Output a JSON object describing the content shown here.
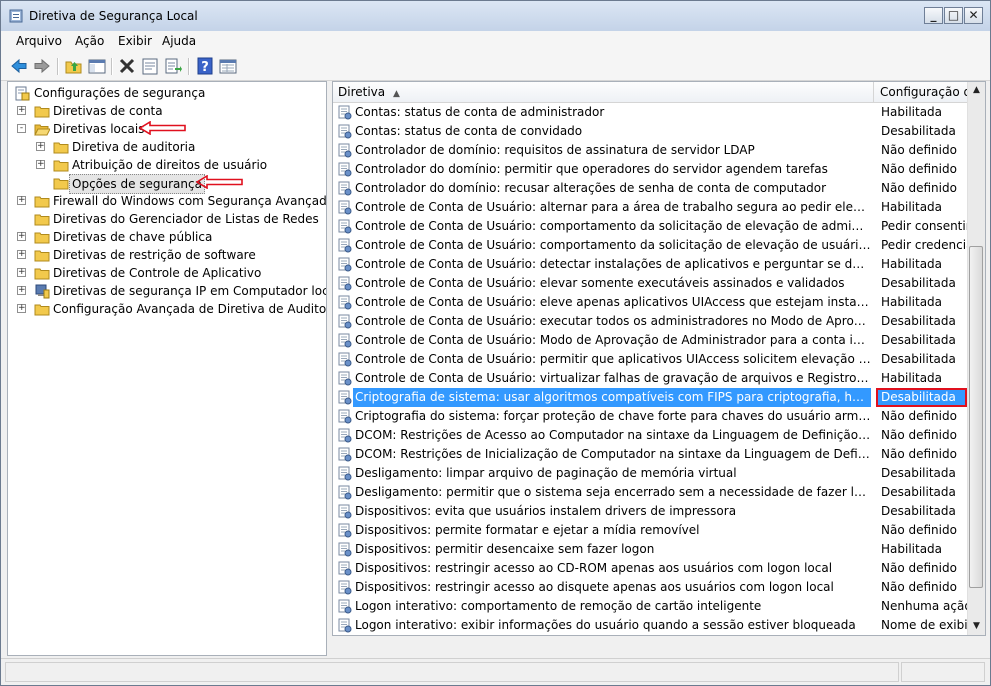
{
  "window": {
    "title": "Diretiva de Segurança Local"
  },
  "menu": [
    "Arquivo",
    "Ação",
    "Exibir",
    "Ajuda"
  ],
  "toolbar": {
    "buttons": [
      "back-icon",
      "forward-icon",
      "up-folder-icon",
      "show-hide-tree-icon",
      "delete-icon",
      "properties-icon",
      "export-list-icon",
      "help-icon",
      "console-view-icon"
    ]
  },
  "tree": {
    "root": "Configurações de segurança",
    "items": [
      {
        "label": "Diretivas de conta",
        "expander": "+"
      },
      {
        "label": "Diretivas locais",
        "expander": "-"
      },
      {
        "label": "Diretiva de auditoria",
        "expander": "+"
      },
      {
        "label": "Atribuição de direitos de usuário",
        "expander": "+"
      },
      {
        "label": "Opções de segurança",
        "expander": ""
      },
      {
        "label": "Firewall do Windows com Segurança Avançada",
        "expander": "+"
      },
      {
        "label": "Diretivas do Gerenciador de Listas de Redes",
        "expander": ""
      },
      {
        "label": "Diretivas de chave pública",
        "expander": "+"
      },
      {
        "label": "Diretivas de restrição de software",
        "expander": "+"
      },
      {
        "label": "Diretivas de Controle de Aplicativo",
        "expander": "+"
      },
      {
        "label": "Diretivas de segurança IP em Computador local",
        "expander": "+"
      },
      {
        "label": "Configuração Avançada de Diretiva de Auditoria",
        "expander": "+"
      }
    ]
  },
  "list": {
    "columns": {
      "policy": "Diretiva",
      "setting": "Configuração de"
    },
    "rows": [
      {
        "policy": "Contas: status de conta de administrador",
        "setting": "Habilitada"
      },
      {
        "policy": "Contas: status de conta de convidado",
        "setting": "Desabilitada"
      },
      {
        "policy": "Controlador de domínio: requisitos de assinatura de servidor LDAP",
        "setting": "Não definido"
      },
      {
        "policy": "Controlador do domínio: permitir que operadores do servidor agendem tarefas",
        "setting": "Não definido"
      },
      {
        "policy": "Controlador do domínio: recusar alterações de senha de conta de computador",
        "setting": "Não definido"
      },
      {
        "policy": "Controle de Conta de Usuário: alternar para a área de trabalho segura ao pedir elevação",
        "setting": "Habilitada"
      },
      {
        "policy": "Controle de Conta de Usuário: comportamento da solicitação de elevação de administradores n...",
        "setting": "Pedir consentim"
      },
      {
        "policy": "Controle de Conta de Usuário: comportamento da solicitação de elevação de usuários padrão",
        "setting": "Pedir credenciais"
      },
      {
        "policy": "Controle de Conta de Usuário: detectar instalações de aplicativos e perguntar se deseja elevar",
        "setting": "Habilitada"
      },
      {
        "policy": "Controle de Conta de Usuário: elevar somente executáveis assinados e validados",
        "setting": "Desabilitada"
      },
      {
        "policy": "Controle de Conta de Usuário: eleve apenas aplicativos UIAccess que estejam instalados em locai...",
        "setting": "Habilitada"
      },
      {
        "policy": "Controle de Conta de Usuário: executar todos os administradores no Modo de Aprovação de Ad...",
        "setting": "Desabilitada"
      },
      {
        "policy": "Controle de Conta de Usuário: Modo de Aprovação de Administrador para a conta interna Admi...",
        "setting": "Desabilitada"
      },
      {
        "policy": "Controle de Conta de Usuário: permitir que aplicativos UIAccess solicitem elevação sem usar a ár...",
        "setting": "Desabilitada"
      },
      {
        "policy": "Controle de Conta de Usuário: virtualizar falhas de gravação de arquivos e Registros para locais p...",
        "setting": "Habilitada"
      },
      {
        "policy": "Criptografia de sistema: usar algoritmos compatíveis com FIPS para criptografia, hash e assinatura",
        "setting": "Desabilitada",
        "selected": true
      },
      {
        "policy": "Criptografia do sistema: forçar proteção de chave forte para chaves do usuário armazenadas no ...",
        "setting": "Não definido"
      },
      {
        "policy": "DCOM: Restrições de Acesso ao Computador na sintaxe da Linguagem de Definição do Descritor...",
        "setting": "Não definido"
      },
      {
        "policy": "DCOM: Restrições de Inicialização de Computador na sintaxe da Linguagem de Definição do Des...",
        "setting": "Não definido"
      },
      {
        "policy": "Desligamento: limpar arquivo de paginação de memória virtual",
        "setting": "Desabilitada"
      },
      {
        "policy": "Desligamento: permitir que o sistema seja encerrado sem a necessidade de fazer logon",
        "setting": "Desabilitada"
      },
      {
        "policy": "Dispositivos: evita que usuários instalem drivers de impressora",
        "setting": "Desabilitada"
      },
      {
        "policy": "Dispositivos: permite formatar e ejetar a mídia removível",
        "setting": "Não definido"
      },
      {
        "policy": "Dispositivos: permitir desencaixe sem fazer logon",
        "setting": "Habilitada"
      },
      {
        "policy": "Dispositivos: restringir acesso ao CD-ROM apenas aos usuários com logon local",
        "setting": "Não definido"
      },
      {
        "policy": "Dispositivos: restringir acesso ao disquete apenas aos usuários com logon local",
        "setting": "Não definido"
      },
      {
        "policy": "Logon interativo: comportamento de remoção de cartão inteligente",
        "setting": "Nenhuma ação"
      },
      {
        "policy": "Logon interativo: exibir informações do usuário quando a sessão estiver bloqueada",
        "setting": "Nome de exibiçã"
      }
    ]
  },
  "colors": {
    "selection": "#3399ff",
    "annotation": "#e0101e",
    "folder": "#f2c94c"
  }
}
